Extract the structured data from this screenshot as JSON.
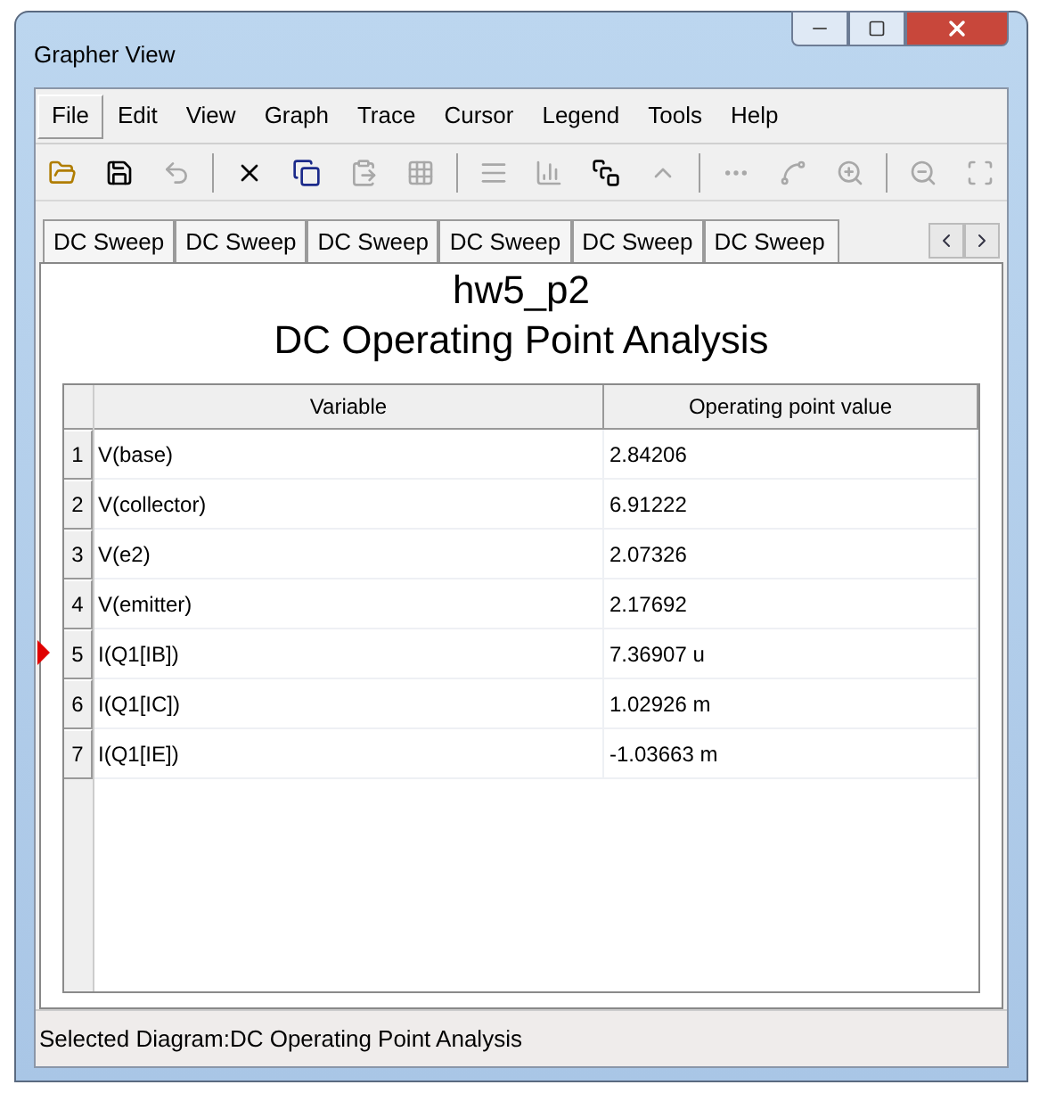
{
  "window": {
    "title": "Grapher View"
  },
  "menu": [
    {
      "label": "File",
      "selected": true
    },
    {
      "label": "Edit",
      "selected": false
    },
    {
      "label": "View",
      "selected": false
    },
    {
      "label": "Graph",
      "selected": false
    },
    {
      "label": "Trace",
      "selected": false
    },
    {
      "label": "Cursor",
      "selected": false
    },
    {
      "label": "Legend",
      "selected": false
    },
    {
      "label": "Tools",
      "selected": false
    },
    {
      "label": "Help",
      "selected": false
    }
  ],
  "toolbar": [
    {
      "disabled": false
    },
    {
      "disabled": false
    },
    {
      "disabled": true
    },
    {
      "disabled": false
    },
    {
      "disabled": false
    },
    {
      "disabled": true
    },
    {
      "disabled": true
    },
    {
      "disabled": true
    },
    {
      "disabled": true
    },
    {
      "disabled": false
    },
    {
      "disabled": true
    },
    {
      "disabled": true
    },
    {
      "disabled": true
    },
    {
      "disabled": true
    },
    {
      "disabled": true
    },
    {
      "disabled": true
    }
  ],
  "tabs": [
    "DC Sweep",
    "DC Sweep",
    "DC Sweep",
    "DC Sweep",
    "DC Sweep",
    "DC Sweep"
  ],
  "title": "hw5_p2",
  "subtitle": "DC Operating Point Analysis",
  "table": {
    "columns": [
      "Variable",
      "Operating point value"
    ],
    "rows": [
      {
        "index": "1",
        "variable": "V(base)",
        "value": "2.84206",
        "selected": false
      },
      {
        "index": "2",
        "variable": "V(collector)",
        "value": "6.91222",
        "selected": false
      },
      {
        "index": "3",
        "variable": "V(e2)",
        "value": "2.07326",
        "selected": false
      },
      {
        "index": "4",
        "variable": "V(emitter)",
        "value": "2.17692",
        "selected": false
      },
      {
        "index": "5",
        "variable": "I(Q1[IB])",
        "value": "7.36907 u",
        "selected": true
      },
      {
        "index": "6",
        "variable": "I(Q1[IC])",
        "value": "1.02926 m",
        "selected": false
      },
      {
        "index": "7",
        "variable": "I(Q1[IE])",
        "value": "-1.03663 m",
        "selected": false
      }
    ]
  },
  "status_bar": "Selected Diagram:DC Operating Point Analysis"
}
